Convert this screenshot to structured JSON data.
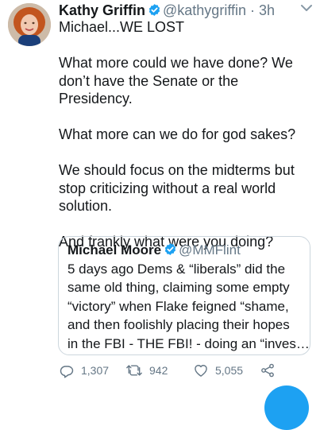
{
  "author": {
    "name": "Kathy Griffin",
    "handle": "@kathygriffin",
    "separator": "·",
    "time": "3h"
  },
  "tweet": {
    "line1": "Michael...WE LOST",
    "para2": "What more could we have done? We don’t have the Senate or the Presidency.",
    "para3": "What more can we do for god sakes?",
    "para4": "We should focus on the midterms but stop criticizing without a real world solution.",
    "para5": "And frankly what were you doing?"
  },
  "quoted": {
    "name": "Michael Moore",
    "handle": "@MMFlint",
    "lines": [
      "5 days ago Dems & “liberals” did the",
      "same old thing, claiming some empty",
      "“victory” when Flake feigned “shame,",
      "and then foolishly placing their hopes",
      "in the FBI - THE FBI! - doing an “inves…"
    ]
  },
  "actions": {
    "reply_count": "1,307",
    "retweet_count": "942",
    "like_count": "5,055"
  },
  "icons": {
    "verified": "verified-badge-icon",
    "caret": "chevron-down-icon",
    "reply": "reply-icon",
    "retweet": "retweet-icon",
    "like": "heart-icon",
    "share": "share-icon"
  },
  "colors": {
    "brand_blue": "#1da1f2",
    "secondary_text": "#657786",
    "border": "#ccd6dd"
  }
}
